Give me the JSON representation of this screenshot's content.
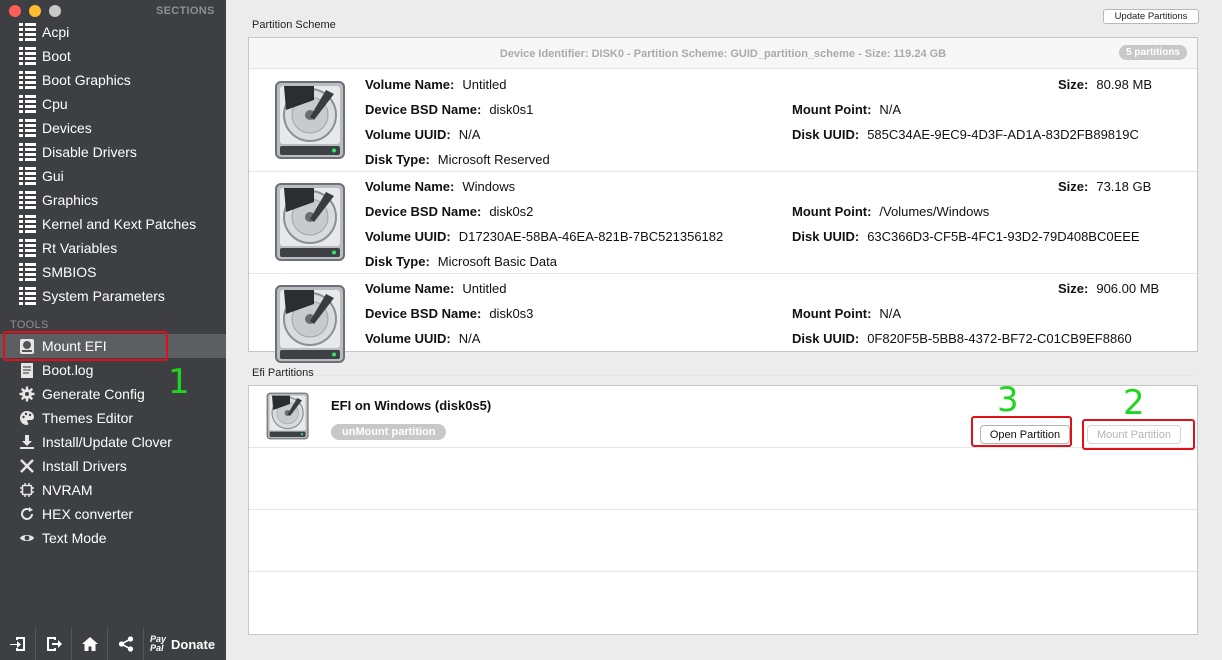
{
  "sidebar": {
    "sections_header": "SECTIONS",
    "tools_header": "TOOLS",
    "sections": [
      {
        "label": "Acpi",
        "icon": "list-icon"
      },
      {
        "label": "Boot",
        "icon": "list-icon"
      },
      {
        "label": "Boot Graphics",
        "icon": "list-icon"
      },
      {
        "label": "Cpu",
        "icon": "list-icon"
      },
      {
        "label": "Devices",
        "icon": "list-icon"
      },
      {
        "label": "Disable Drivers",
        "icon": "list-icon"
      },
      {
        "label": "Gui",
        "icon": "list-icon"
      },
      {
        "label": "Graphics",
        "icon": "list-icon"
      },
      {
        "label": "Kernel and Kext Patches",
        "icon": "list-icon"
      },
      {
        "label": "Rt Variables",
        "icon": "list-icon"
      },
      {
        "label": "SMBIOS",
        "icon": "list-icon"
      },
      {
        "label": "System Parameters",
        "icon": "list-icon"
      }
    ],
    "tools": [
      {
        "label": "Mount EFI",
        "icon": "disk-utility-icon"
      },
      {
        "label": "Boot.log",
        "icon": "document-icon"
      },
      {
        "label": "Generate Config",
        "icon": "gear-icon"
      },
      {
        "label": "Themes Editor",
        "icon": "palette-icon"
      },
      {
        "label": "Install/Update Clover",
        "icon": "install-icon"
      },
      {
        "label": "Install Drivers",
        "icon": "tools-icon"
      },
      {
        "label": "NVRAM",
        "icon": "chip-icon"
      },
      {
        "label": "HEX converter",
        "icon": "refresh-icon"
      },
      {
        "label": "Text Mode",
        "icon": "eye-icon"
      }
    ],
    "bottom": {
      "paypal_line1": "Pay",
      "paypal_line2": "Pal",
      "donate_label": "Donate"
    }
  },
  "annotations": {
    "num1": "1",
    "num2": "2",
    "num3": "3",
    "color": "#1fd61f"
  },
  "partition_scheme": {
    "group_label": "Partition Scheme",
    "update_button": "Update Partitions",
    "header": "Device Identifier: DISK0 - Partition Scheme: GUID_partition_scheme - Size: 119.24 GB",
    "count_badge": "5 partitions",
    "labels": {
      "volume_name": "Volume Name:",
      "bsd_name": "Device BSD Name:",
      "volume_uuid": "Volume UUID:",
      "disk_type": "Disk Type:",
      "size": "Size:",
      "mount_point": "Mount Point:",
      "disk_uuid": "Disk UUID:"
    },
    "partitions": [
      {
        "volume_name": "Untitled",
        "bsd_name": "disk0s1",
        "volume_uuid": "N/A",
        "disk_type": "Microsoft Reserved",
        "size": "80.98 MB",
        "mount_point": "N/A",
        "disk_uuid": "585C34AE-9EC9-4D3F-AD1A-83D2FB89819C"
      },
      {
        "volume_name": "Windows",
        "bsd_name": "disk0s2",
        "volume_uuid": "D17230AE-58BA-46EA-821B-7BC521356182",
        "disk_type": "Microsoft Basic Data",
        "size": "73.18 GB",
        "mount_point": "/Volumes/Windows",
        "disk_uuid": "63C366D3-CF5B-4FC1-93D2-79D408BC0EEE"
      },
      {
        "volume_name": "Untitled",
        "bsd_name": "disk0s3",
        "volume_uuid": "N/A",
        "disk_type": "",
        "size": "906.00 MB",
        "mount_point": "N/A",
        "disk_uuid": "0F820F5B-5BB8-4372-BF72-C01CB9EF8860"
      }
    ]
  },
  "efi": {
    "group_label": "Efi Partitions",
    "title": "EFI on Windows (disk0s5)",
    "unmount_label": "unMount partition",
    "open_button": "Open Partition",
    "mount_button": "Mount Partition"
  }
}
